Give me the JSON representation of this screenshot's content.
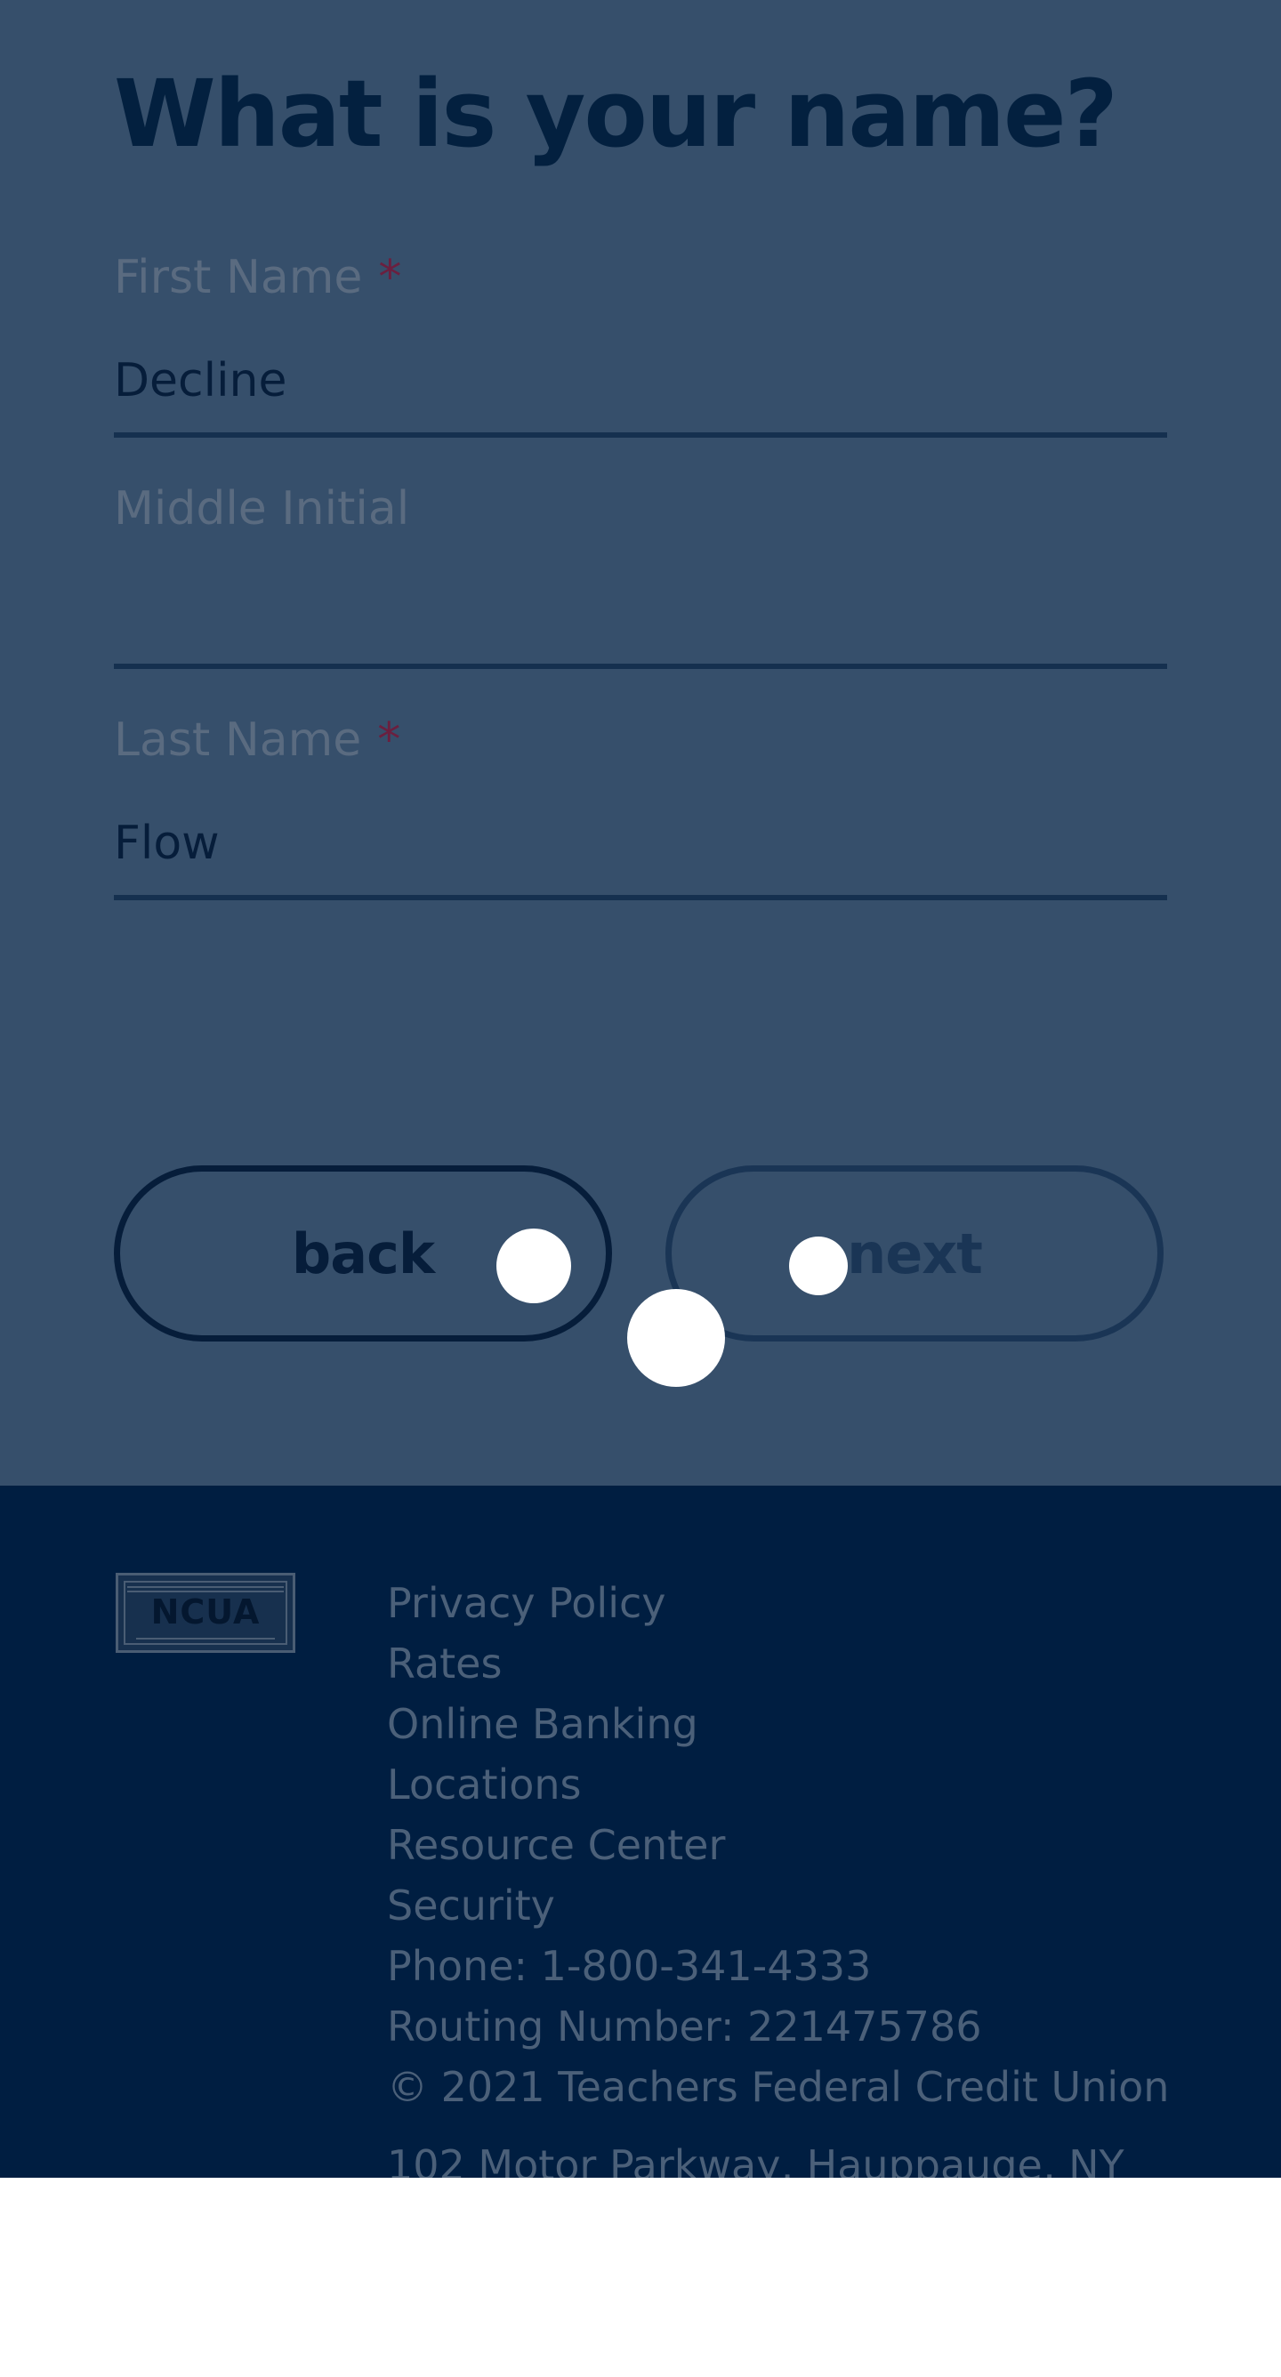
{
  "form": {
    "title": "What is your name?",
    "fields": [
      {
        "label": "First Name",
        "required_mark": "*",
        "value": "Decline"
      },
      {
        "label": "Middle Initial",
        "required_mark": "",
        "value": ""
      },
      {
        "label": "Last Name",
        "required_mark": "*",
        "value": "Flow"
      }
    ],
    "back_label": "back",
    "next_label": "next"
  },
  "footer": {
    "logo_text": "NCUA",
    "links": [
      "Privacy Policy",
      "Rates",
      "Online Banking",
      "Locations",
      "Resource Center",
      "Security"
    ],
    "phone": "Phone: 1-800-341-4333",
    "routing": "Routing Number: 221475786",
    "copyright": "© 2021 Teachers Federal Credit Union",
    "address": "102 Motor Parkway, Hauppauge, NY"
  },
  "colors": {
    "form_background": "#364f6b",
    "title": "#03203f",
    "required_mark": "#6b1f3f",
    "footer_background": "#001e41",
    "footer_text": "#4b6079"
  }
}
